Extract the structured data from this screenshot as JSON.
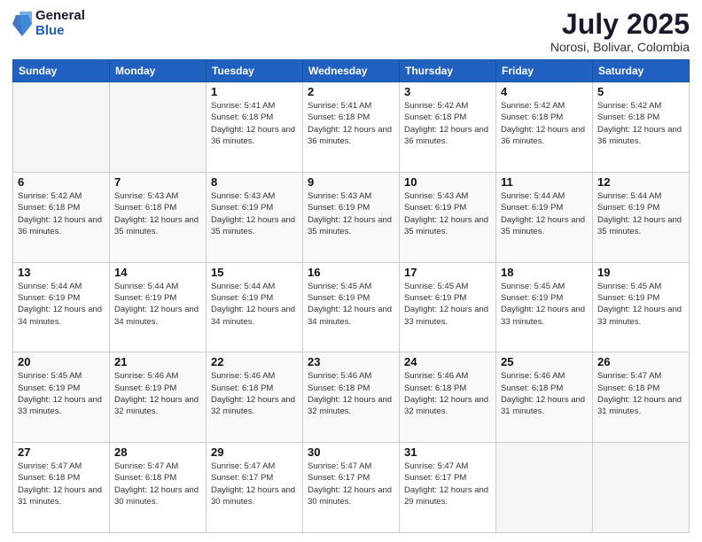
{
  "logo": {
    "general": "General",
    "blue": "Blue"
  },
  "header": {
    "month": "July 2025",
    "location": "Norosi, Bolivar, Colombia"
  },
  "weekdays": [
    "Sunday",
    "Monday",
    "Tuesday",
    "Wednesday",
    "Thursday",
    "Friday",
    "Saturday"
  ],
  "weeks": [
    [
      {
        "day": "",
        "sunrise": "",
        "sunset": "",
        "daylight": ""
      },
      {
        "day": "",
        "sunrise": "",
        "sunset": "",
        "daylight": ""
      },
      {
        "day": "1",
        "sunrise": "Sunrise: 5:41 AM",
        "sunset": "Sunset: 6:18 PM",
        "daylight": "Daylight: 12 hours and 36 minutes."
      },
      {
        "day": "2",
        "sunrise": "Sunrise: 5:41 AM",
        "sunset": "Sunset: 6:18 PM",
        "daylight": "Daylight: 12 hours and 36 minutes."
      },
      {
        "day": "3",
        "sunrise": "Sunrise: 5:42 AM",
        "sunset": "Sunset: 6:18 PM",
        "daylight": "Daylight: 12 hours and 36 minutes."
      },
      {
        "day": "4",
        "sunrise": "Sunrise: 5:42 AM",
        "sunset": "Sunset: 6:18 PM",
        "daylight": "Daylight: 12 hours and 36 minutes."
      },
      {
        "day": "5",
        "sunrise": "Sunrise: 5:42 AM",
        "sunset": "Sunset: 6:18 PM",
        "daylight": "Daylight: 12 hours and 36 minutes."
      }
    ],
    [
      {
        "day": "6",
        "sunrise": "Sunrise: 5:42 AM",
        "sunset": "Sunset: 6:18 PM",
        "daylight": "Daylight: 12 hours and 36 minutes."
      },
      {
        "day": "7",
        "sunrise": "Sunrise: 5:43 AM",
        "sunset": "Sunset: 6:18 PM",
        "daylight": "Daylight: 12 hours and 35 minutes."
      },
      {
        "day": "8",
        "sunrise": "Sunrise: 5:43 AM",
        "sunset": "Sunset: 6:19 PM",
        "daylight": "Daylight: 12 hours and 35 minutes."
      },
      {
        "day": "9",
        "sunrise": "Sunrise: 5:43 AM",
        "sunset": "Sunset: 6:19 PM",
        "daylight": "Daylight: 12 hours and 35 minutes."
      },
      {
        "day": "10",
        "sunrise": "Sunrise: 5:43 AM",
        "sunset": "Sunset: 6:19 PM",
        "daylight": "Daylight: 12 hours and 35 minutes."
      },
      {
        "day": "11",
        "sunrise": "Sunrise: 5:44 AM",
        "sunset": "Sunset: 6:19 PM",
        "daylight": "Daylight: 12 hours and 35 minutes."
      },
      {
        "day": "12",
        "sunrise": "Sunrise: 5:44 AM",
        "sunset": "Sunset: 6:19 PM",
        "daylight": "Daylight: 12 hours and 35 minutes."
      }
    ],
    [
      {
        "day": "13",
        "sunrise": "Sunrise: 5:44 AM",
        "sunset": "Sunset: 6:19 PM",
        "daylight": "Daylight: 12 hours and 34 minutes."
      },
      {
        "day": "14",
        "sunrise": "Sunrise: 5:44 AM",
        "sunset": "Sunset: 6:19 PM",
        "daylight": "Daylight: 12 hours and 34 minutes."
      },
      {
        "day": "15",
        "sunrise": "Sunrise: 5:44 AM",
        "sunset": "Sunset: 6:19 PM",
        "daylight": "Daylight: 12 hours and 34 minutes."
      },
      {
        "day": "16",
        "sunrise": "Sunrise: 5:45 AM",
        "sunset": "Sunset: 6:19 PM",
        "daylight": "Daylight: 12 hours and 34 minutes."
      },
      {
        "day": "17",
        "sunrise": "Sunrise: 5:45 AM",
        "sunset": "Sunset: 6:19 PM",
        "daylight": "Daylight: 12 hours and 33 minutes."
      },
      {
        "day": "18",
        "sunrise": "Sunrise: 5:45 AM",
        "sunset": "Sunset: 6:19 PM",
        "daylight": "Daylight: 12 hours and 33 minutes."
      },
      {
        "day": "19",
        "sunrise": "Sunrise: 5:45 AM",
        "sunset": "Sunset: 6:19 PM",
        "daylight": "Daylight: 12 hours and 33 minutes."
      }
    ],
    [
      {
        "day": "20",
        "sunrise": "Sunrise: 5:45 AM",
        "sunset": "Sunset: 6:19 PM",
        "daylight": "Daylight: 12 hours and 33 minutes."
      },
      {
        "day": "21",
        "sunrise": "Sunrise: 5:46 AM",
        "sunset": "Sunset: 6:19 PM",
        "daylight": "Daylight: 12 hours and 32 minutes."
      },
      {
        "day": "22",
        "sunrise": "Sunrise: 5:46 AM",
        "sunset": "Sunset: 6:18 PM",
        "daylight": "Daylight: 12 hours and 32 minutes."
      },
      {
        "day": "23",
        "sunrise": "Sunrise: 5:46 AM",
        "sunset": "Sunset: 6:18 PM",
        "daylight": "Daylight: 12 hours and 32 minutes."
      },
      {
        "day": "24",
        "sunrise": "Sunrise: 5:46 AM",
        "sunset": "Sunset: 6:18 PM",
        "daylight": "Daylight: 12 hours and 32 minutes."
      },
      {
        "day": "25",
        "sunrise": "Sunrise: 5:46 AM",
        "sunset": "Sunset: 6:18 PM",
        "daylight": "Daylight: 12 hours and 31 minutes."
      },
      {
        "day": "26",
        "sunrise": "Sunrise: 5:47 AM",
        "sunset": "Sunset: 6:18 PM",
        "daylight": "Daylight: 12 hours and 31 minutes."
      }
    ],
    [
      {
        "day": "27",
        "sunrise": "Sunrise: 5:47 AM",
        "sunset": "Sunset: 6:18 PM",
        "daylight": "Daylight: 12 hours and 31 minutes."
      },
      {
        "day": "28",
        "sunrise": "Sunrise: 5:47 AM",
        "sunset": "Sunset: 6:18 PM",
        "daylight": "Daylight: 12 hours and 30 minutes."
      },
      {
        "day": "29",
        "sunrise": "Sunrise: 5:47 AM",
        "sunset": "Sunset: 6:17 PM",
        "daylight": "Daylight: 12 hours and 30 minutes."
      },
      {
        "day": "30",
        "sunrise": "Sunrise: 5:47 AM",
        "sunset": "Sunset: 6:17 PM",
        "daylight": "Daylight: 12 hours and 30 minutes."
      },
      {
        "day": "31",
        "sunrise": "Sunrise: 5:47 AM",
        "sunset": "Sunset: 6:17 PM",
        "daylight": "Daylight: 12 hours and 29 minutes."
      },
      {
        "day": "",
        "sunrise": "",
        "sunset": "",
        "daylight": ""
      },
      {
        "day": "",
        "sunrise": "",
        "sunset": "",
        "daylight": ""
      }
    ]
  ]
}
